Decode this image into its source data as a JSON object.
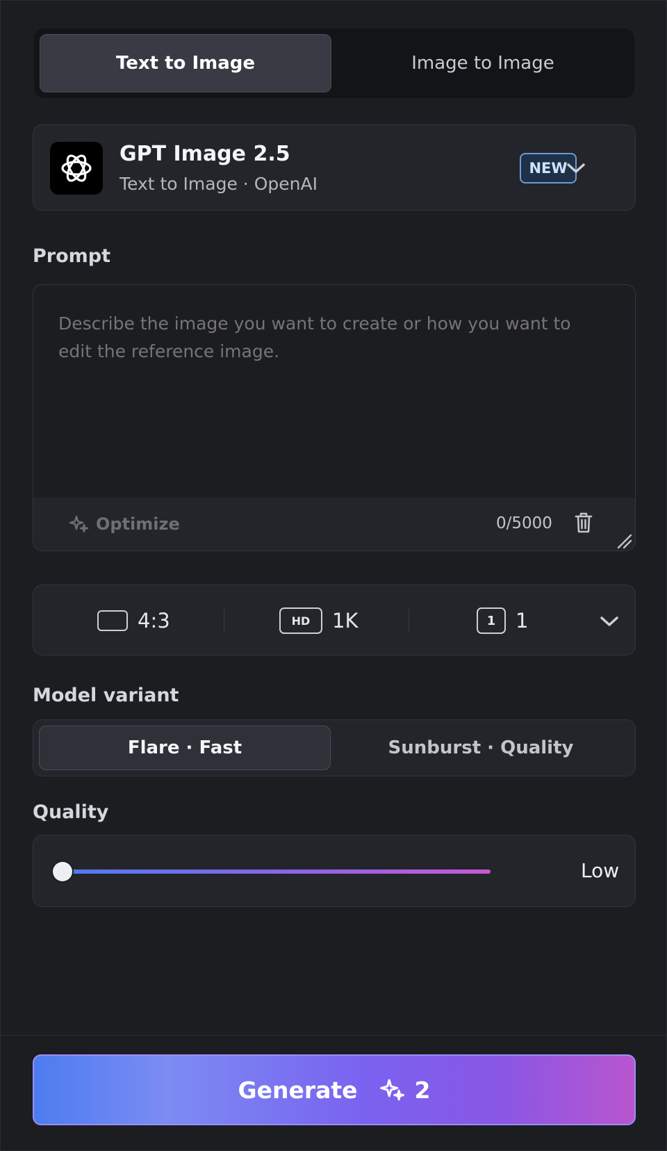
{
  "mode_tabs": [
    {
      "label": "Text to Image",
      "active": true
    },
    {
      "label": "Image to Image",
      "active": false
    }
  ],
  "model": {
    "name": "GPT Image 2.5",
    "subtitle": "Text to Image · OpenAI",
    "badge": "NEW",
    "logo_icon": "openai-logo-icon"
  },
  "prompt": {
    "label": "Prompt",
    "value": "",
    "placeholder": "Describe the image you want to create or how you want to edit the reference image.",
    "optimize_label": "Optimize",
    "counter": "0/5000"
  },
  "options": {
    "aspect_ratio": "4:3",
    "resolution_icon_text": "HD",
    "resolution": "1K",
    "count_icon_text": "1",
    "count": "1"
  },
  "model_variant": {
    "label": "Model variant",
    "options": [
      {
        "label": "Flare · Fast",
        "active": true
      },
      {
        "label": "Sunburst · Quality",
        "active": false
      }
    ]
  },
  "quality": {
    "label": "Quality",
    "value_label": "Low",
    "level": 0
  },
  "generate": {
    "label": "Generate",
    "cost": "2"
  },
  "colors": {
    "background": "#1c1d21",
    "accent_start": "#4d7cf0",
    "accent_end": "#c85ad6",
    "badge_border": "#6d9bd6"
  }
}
